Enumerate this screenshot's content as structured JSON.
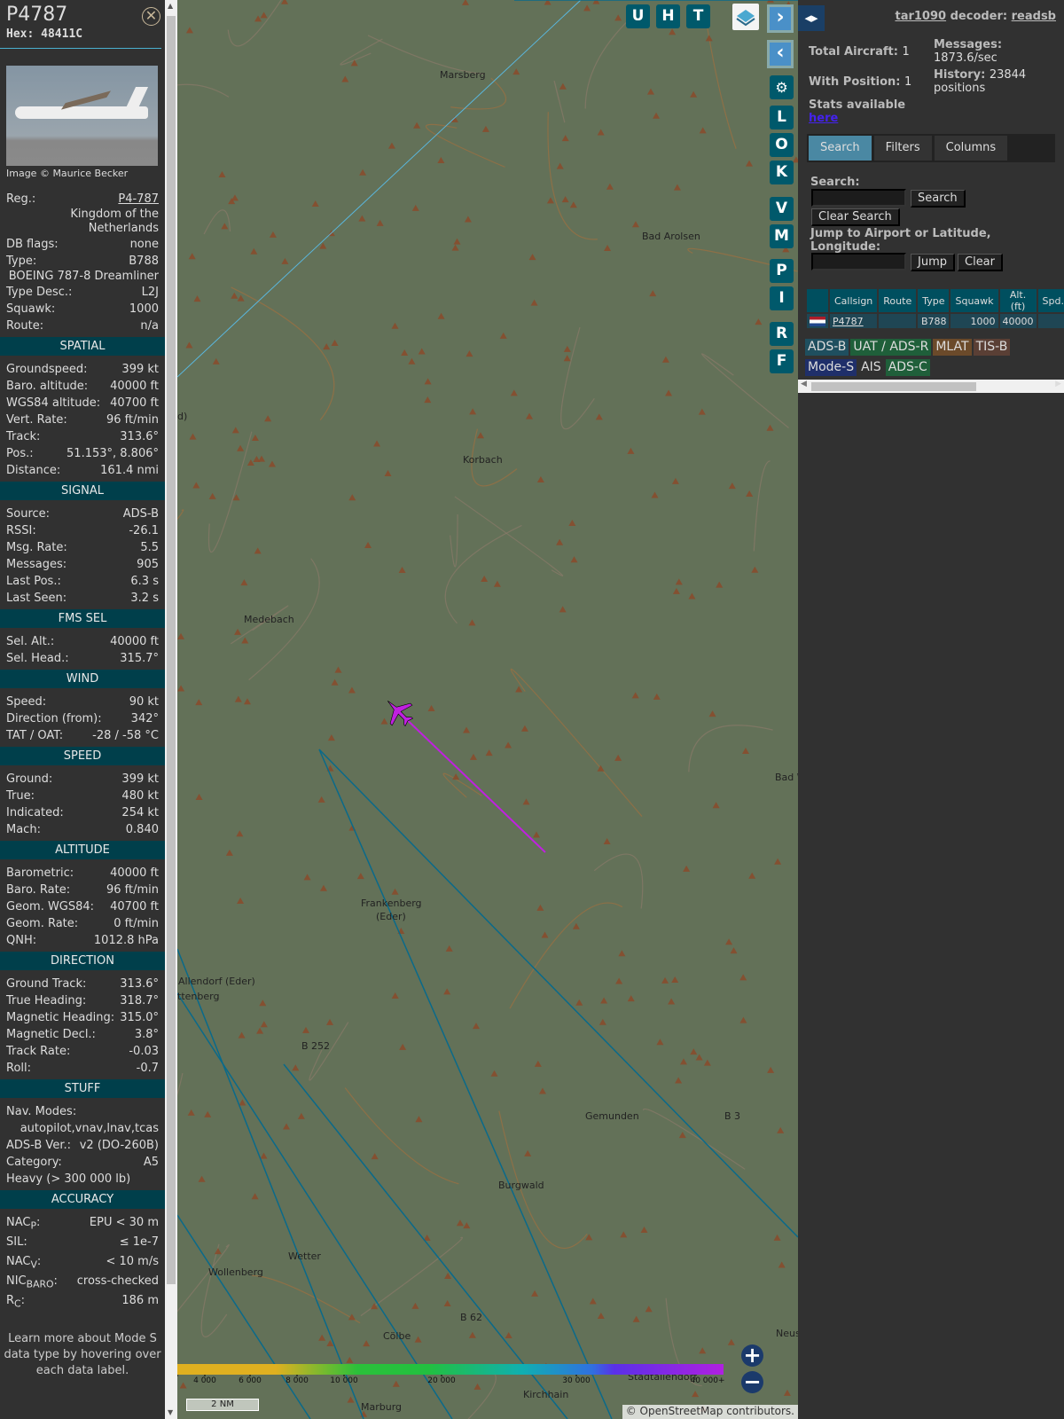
{
  "aircraft": {
    "callsign": "P4787",
    "hex_label": "Hex:",
    "hex": "48411C",
    "photo_credit": "Image © Maurice Becker"
  },
  "info": [
    {
      "label": "Reg.:",
      "value": "P4-787",
      "link": true
    },
    {
      "full": "Kingdom of the Netherlands"
    },
    {
      "label": "DB flags:",
      "value": "none"
    },
    {
      "label": "Type:",
      "value": "B788"
    },
    {
      "full": "BOEING 787-8 Dreamliner"
    },
    {
      "label": "Type Desc.:",
      "value": "L2J"
    },
    {
      "label": "Squawk:",
      "value": "1000"
    },
    {
      "label": "Route:",
      "value": "n/a"
    }
  ],
  "sections": [
    {
      "title": "SPATIAL",
      "rows": [
        [
          "Groundspeed:",
          "399 kt"
        ],
        [
          "Baro. altitude:",
          "40000 ft"
        ],
        [
          "WGS84 altitude:",
          "40700 ft"
        ],
        [
          "Vert. Rate:",
          "96 ft/min"
        ],
        [
          "Track:",
          "313.6°"
        ],
        [
          "Pos.:",
          "51.153°, 8.806°"
        ],
        [
          "Distance:",
          "161.4 nmi"
        ]
      ]
    },
    {
      "title": "SIGNAL",
      "rows": [
        [
          "Source:",
          "ADS-B"
        ],
        [
          "RSSI:",
          "-26.1"
        ],
        [
          "Msg. Rate:",
          "5.5"
        ],
        [
          "Messages:",
          "905"
        ],
        [
          "Last Pos.:",
          "6.3 s"
        ],
        [
          "Last Seen:",
          "3.2 s"
        ]
      ]
    },
    {
      "title": "FMS SEL",
      "rows": [
        [
          "Sel. Alt.:",
          "40000 ft"
        ],
        [
          "Sel. Head.:",
          "315.7°"
        ]
      ]
    },
    {
      "title": "WIND",
      "rows": [
        [
          "Speed:",
          "90 kt"
        ],
        [
          "Direction (from):",
          "342°"
        ],
        [
          "TAT / OAT:",
          "-28 / -58 °C"
        ]
      ]
    },
    {
      "title": "SPEED",
      "rows": [
        [
          "Ground:",
          "399 kt"
        ],
        [
          "True:",
          "480 kt"
        ],
        [
          "Indicated:",
          "254 kt"
        ],
        [
          "Mach:",
          "0.840"
        ]
      ]
    },
    {
      "title": "ALTITUDE",
      "rows": [
        [
          "Barometric:",
          "40000 ft"
        ],
        [
          "Baro. Rate:",
          "96 ft/min"
        ],
        [
          "Geom. WGS84:",
          "40700 ft"
        ],
        [
          "Geom. Rate:",
          "0 ft/min"
        ],
        [
          "QNH:",
          "1012.8 hPa"
        ]
      ]
    },
    {
      "title": "DIRECTION",
      "rows": [
        [
          "Ground Track:",
          "313.6°"
        ],
        [
          "True Heading:",
          "318.7°"
        ],
        [
          "Magnetic Heading:",
          "315.0°"
        ],
        [
          "Magnetic Decl.:",
          "3.8°"
        ],
        [
          "Track Rate:",
          "-0.03"
        ],
        [
          "Roll:",
          "-0.7"
        ]
      ]
    }
  ],
  "stuff": {
    "title": "STUFF",
    "nav_modes_label": "Nav. Modes:",
    "nav_modes": "autopilot,vnav,lnav,tcas",
    "adsb_ver_label": "ADS-B Ver.:",
    "adsb_ver": "v2 (DO-260B)",
    "category_label": "Category:",
    "category": "A5",
    "category_desc": "Heavy (> 300 000 lb)"
  },
  "accuracy": {
    "title": "ACCURACY",
    "rows": [
      [
        "NAC",
        "P",
        ":",
        "EPU < 30 m"
      ],
      [
        "SIL",
        "",
        ":",
        "≤ 1e-7"
      ],
      [
        "NAC",
        "V",
        ":",
        "< 10 m/s"
      ],
      [
        "NIC",
        "BARO",
        ":",
        "cross-checked"
      ],
      [
        "R",
        "C",
        ":",
        "186 m"
      ]
    ]
  },
  "note": "Learn more about Mode S data type by hovering over each data label.",
  "map": {
    "buttons_top": [
      "U",
      "H",
      "T"
    ],
    "buttons_side": [
      "L",
      "O",
      "K",
      "V",
      "M",
      "P",
      "I",
      "R",
      "F"
    ],
    "places": [
      "Marsberg",
      "Bad Arolsen",
      "Korbach",
      "Medebach",
      "Frankenberg",
      "(Eder)",
      "Allendorf (Eder)",
      "Gemunden",
      "Burgwald",
      "Wetter",
      "Cölbe",
      "Marburg",
      "Kirchhain",
      "Stadtallendorf",
      "Neustad",
      "Bad W",
      "B 252",
      "B 62",
      "B 3",
      "Wollenberg",
      "ttenberg",
      "d)"
    ],
    "altitude_ticks": [
      "4 000",
      "6 000",
      "8 000",
      "10 000",
      "20 000",
      "30 000",
      "40 000+"
    ],
    "scale": "2 NM",
    "attribution_prefix": "© ",
    "attribution_link": "OpenStreetMap",
    "attribution_suffix": " contributors.",
    "colors": {
      "track": "#c020e0",
      "aircraft": "#c020e0",
      "range": "#0a6a8a"
    }
  },
  "right": {
    "site": "tar1090",
    "decoder_label": "decoder:",
    "decoder": "readsb",
    "total_label": "Total Aircraft:",
    "total": "1",
    "pos_label": "With Position:",
    "pos": "1",
    "msg_label": "Messages:",
    "msg": "1873.6/sec",
    "hist_label": "History:",
    "hist": "23844 positions",
    "stats_label": "Stats available",
    "stats_link": "here",
    "tabs": [
      "Search",
      "Filters",
      "Columns"
    ],
    "search_label": "Search:",
    "search_btn": "Search",
    "clear_search": "Clear Search",
    "jump_label": "Jump to Airport or Latitude, Longitude:",
    "jump_btn": "Jump",
    "clear_btn": "Clear",
    "columns": [
      "",
      "Callsign",
      "Route",
      "Type",
      "Squawk",
      "Alt. (ft)",
      "Spd."
    ],
    "row": {
      "callsign": "P4787",
      "route": "",
      "type": "B788",
      "squawk": "1000",
      "alt": "40000",
      "spd": ""
    },
    "sources": [
      {
        "label": "ADS-B",
        "color": "#1f4f5f"
      },
      {
        "label": "UAT / ADS-R",
        "color": "#1f5f3a"
      },
      {
        "label": "MLAT",
        "color": "#6b4a2a"
      },
      {
        "label": "TIS-B",
        "color": "#5a3f35"
      },
      {
        "label": "Mode-S",
        "color": "#1f2f6a"
      },
      {
        "label": "AIS",
        "color": "transparent"
      },
      {
        "label": "ADS-C",
        "color": "#1f5f3a"
      }
    ]
  }
}
